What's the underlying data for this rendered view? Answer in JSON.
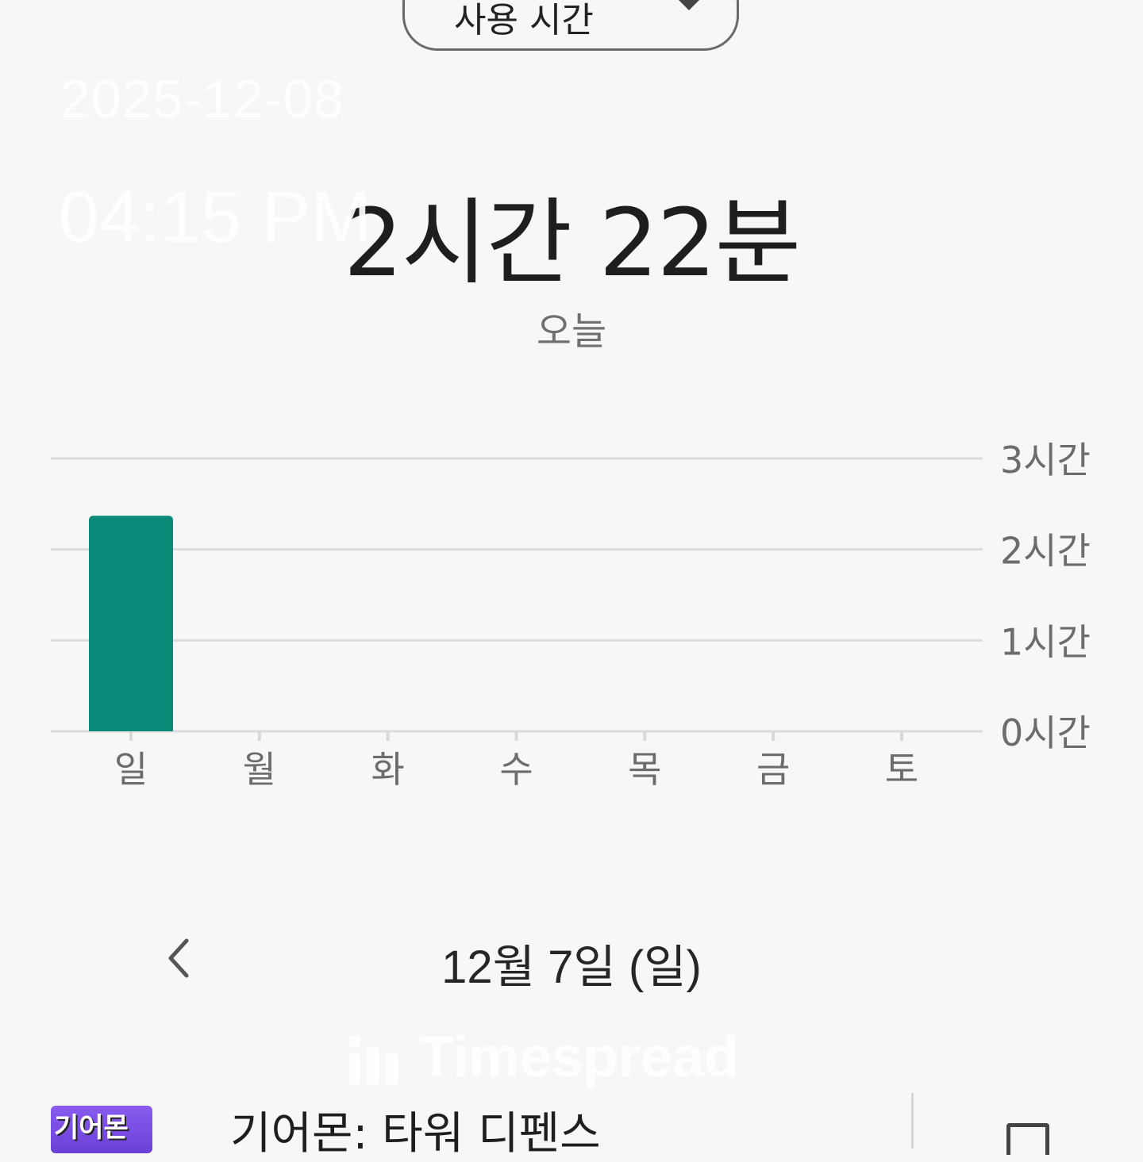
{
  "header": {
    "dropdown_label": "사용 시간"
  },
  "overlay": {
    "date": "2025-12-08",
    "time": "04:15 PM",
    "brand": "Timespread"
  },
  "summary": {
    "total": "2시간 22분",
    "period": "오늘"
  },
  "chart_data": {
    "type": "bar",
    "categories": [
      "일",
      "월",
      "화",
      "수",
      "목",
      "금",
      "토"
    ],
    "values": [
      2.37,
      0,
      0,
      0,
      0,
      0,
      0
    ],
    "y_ticks": [
      "0시간",
      "1시간",
      "2시간",
      "3시간"
    ],
    "ylim": [
      0,
      3
    ],
    "grid": true,
    "bar_color": "#0a8a78"
  },
  "date_nav": {
    "label": "12월 7일 (일)"
  },
  "apps": [
    {
      "name": "기어몬: 타워 디펜스",
      "icon_text": "기어몬"
    }
  ],
  "colors": {
    "background": "#f7f7f7",
    "accent": "#0a8a78"
  }
}
